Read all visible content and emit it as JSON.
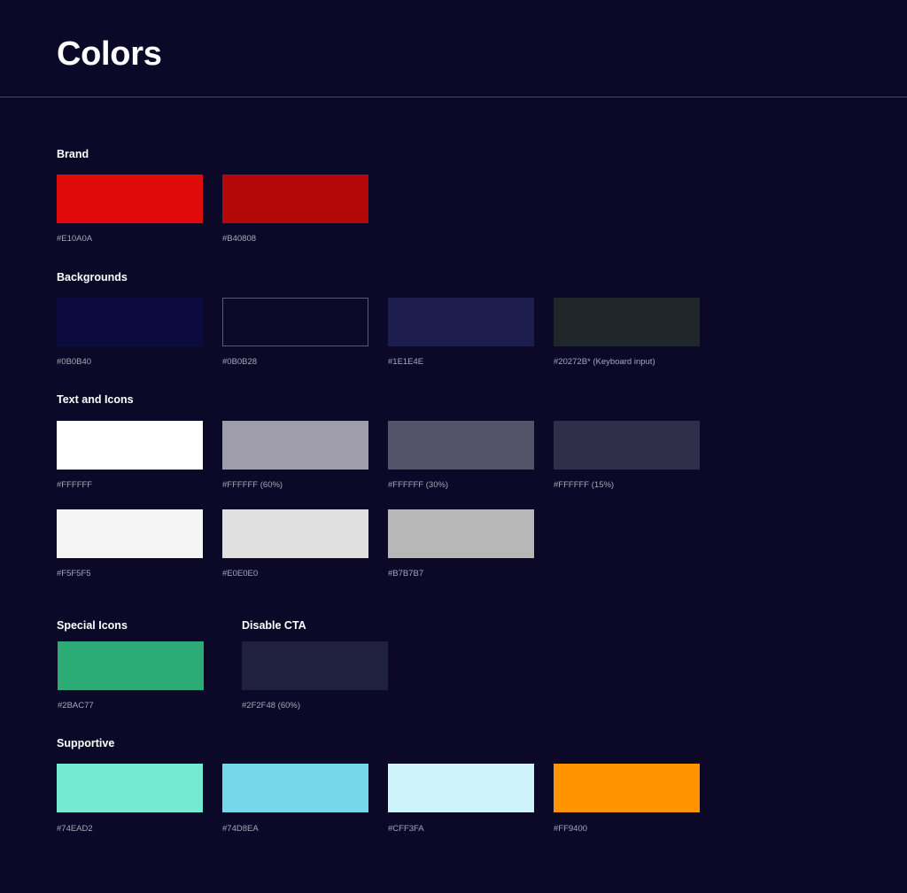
{
  "page": {
    "title": "Colors"
  },
  "sections": {
    "brand": {
      "title": "Brand",
      "swatches": [
        {
          "color": "#E10A0A",
          "label": "#E10A0A"
        },
        {
          "color": "#B40808",
          "label": "#B40808"
        }
      ]
    },
    "backgrounds": {
      "title": "Backgrounds",
      "swatches": [
        {
          "color": "#0B0B40",
          "label": "#0B0B40"
        },
        {
          "color": "#0B0B28",
          "label": "#0B0B28"
        },
        {
          "color": "#1E1E4E",
          "label": "#1E1E4E"
        },
        {
          "color": "#20272B",
          "label": "#20272B* (Keyboard input)"
        }
      ]
    },
    "text_icons": {
      "title": "Text and Icons",
      "swatches": [
        {
          "color": "#FFFFFF",
          "label": "#FFFFFF"
        },
        {
          "color": "#9E9DA9",
          "label": "#FFFFFF (60%)"
        },
        {
          "color": "#54536A",
          "label": "#FFFFFF (30%)"
        },
        {
          "color": "#302E48",
          "label": "#FFFFFF (15%)"
        },
        {
          "color": "#F5F5F5",
          "label": "#F5F5F5"
        },
        {
          "color": "#E0E0E0",
          "label": "#E0E0E0"
        },
        {
          "color": "#B7B7B7",
          "label": "#B7B7B7"
        }
      ]
    },
    "special_icons": {
      "title": "Special Icons",
      "swatches": [
        {
          "color": "#2BAC77",
          "label": "#2BAC77"
        }
      ]
    },
    "disable_cta": {
      "title": "Disable CTA",
      "swatches": [
        {
          "color": "#1F213D",
          "label": "#2F2F48 (60%)"
        }
      ]
    },
    "supportive": {
      "title": "Supportive",
      "swatches": [
        {
          "color": "#74EAD2",
          "label": "#74EAD2"
        },
        {
          "color": "#74D8EA",
          "label": "#74D8EA"
        },
        {
          "color": "#CFF3FA",
          "label": "#CFF3FA"
        },
        {
          "color": "#FF9400",
          "label": "#FF9400"
        }
      ]
    }
  }
}
